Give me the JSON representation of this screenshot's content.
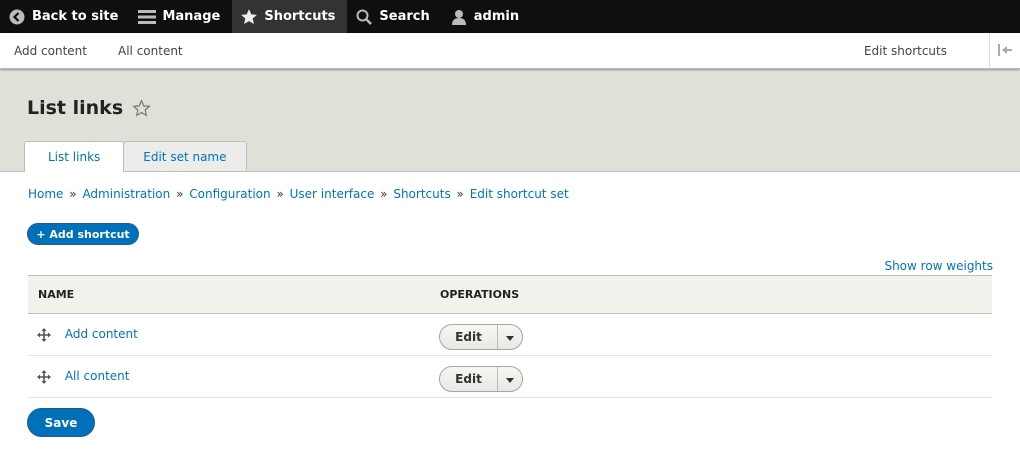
{
  "toolbar": {
    "back": "Back to site",
    "manage": "Manage",
    "shortcuts": "Shortcuts",
    "search": "Search",
    "user": "admin"
  },
  "tray": {
    "add_content": "Add content",
    "all_content": "All content",
    "edit_shortcuts": "Edit shortcuts"
  },
  "page": {
    "title": "List links",
    "tabs": [
      "List links",
      "Edit set name"
    ]
  },
  "breadcrumb": [
    "Home",
    "Administration",
    "Configuration",
    "User interface",
    "Shortcuts",
    "Edit shortcut set"
  ],
  "breadcrumb_sep": "»",
  "actions": {
    "add_shortcut": "+ Add shortcut",
    "show_weights": "Show row weights",
    "save": "Save"
  },
  "table": {
    "headers": [
      "NAME",
      "OPERATIONS"
    ],
    "rows": [
      {
        "name": "Add content",
        "op": "Edit"
      },
      {
        "name": "All content",
        "op": "Edit"
      }
    ]
  },
  "colors": {
    "link": "#0074bd",
    "primary_button": "#0071b8",
    "toolbar_bg": "#0f0f0f",
    "header_bg": "#e0e0d8"
  }
}
